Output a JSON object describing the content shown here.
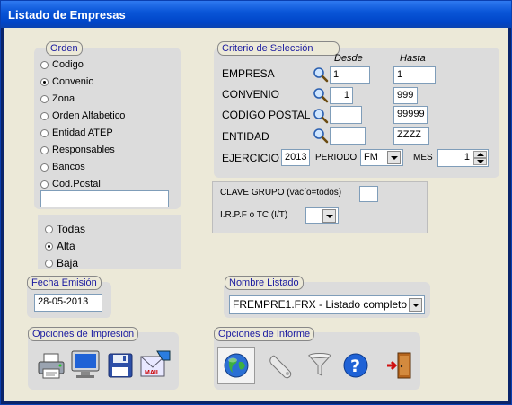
{
  "window": {
    "title": "Listado de Empresas"
  },
  "orden": {
    "legend": "Orden",
    "options": [
      "Codigo",
      "Convenio",
      "Zona",
      "Orden Alfabetico",
      "Entidad ATEP",
      "Responsables",
      "Bancos",
      "Cod.Postal"
    ],
    "selected": "Convenio",
    "text_value": ""
  },
  "estado": {
    "options": [
      "Todas",
      "Alta",
      "Baja"
    ],
    "selected": "Alta"
  },
  "criterio": {
    "legend": "Criterio de Selección",
    "desde_header": "Desde",
    "hasta_header": "Hasta",
    "rows": [
      {
        "label": "EMPRESA",
        "desde": "1",
        "hasta": "1"
      },
      {
        "label": "CONVENIO",
        "desde": "1",
        "hasta": "999"
      },
      {
        "label": "CODIGO POSTAL",
        "desde": "",
        "hasta": "99999"
      },
      {
        "label": "ENTIDAD",
        "desde": "",
        "hasta": "ZZZZ"
      }
    ],
    "ejercicio_label": "EJERCICIO",
    "ejercicio_value": "2013",
    "periodo_label": "PERIODO",
    "periodo_value": "FM",
    "mes_label": "MES",
    "mes_value": "1"
  },
  "grupo": {
    "clave_label": "CLAVE GRUPO (vacío=todos)",
    "clave_value": "",
    "irpf_label": "I.R.P.F o TC (I/T)",
    "irpf_value": ""
  },
  "fecha": {
    "legend": "Fecha Emisión",
    "value": "28-05-2013"
  },
  "listado": {
    "legend": "Nombre Listado",
    "value": "FREMPRE1.FRX - Listado completo"
  },
  "impresion": {
    "legend": "Opciones de Impresión",
    "icons": [
      "printer-icon",
      "monitor-icon",
      "floppy-disk-icon",
      "mail-icon"
    ]
  },
  "informe": {
    "legend": "Opciones de Informe",
    "icons": [
      "globe-icon",
      "wrench-icon",
      "filter-icon",
      "help-icon",
      "exit-door-icon"
    ]
  }
}
